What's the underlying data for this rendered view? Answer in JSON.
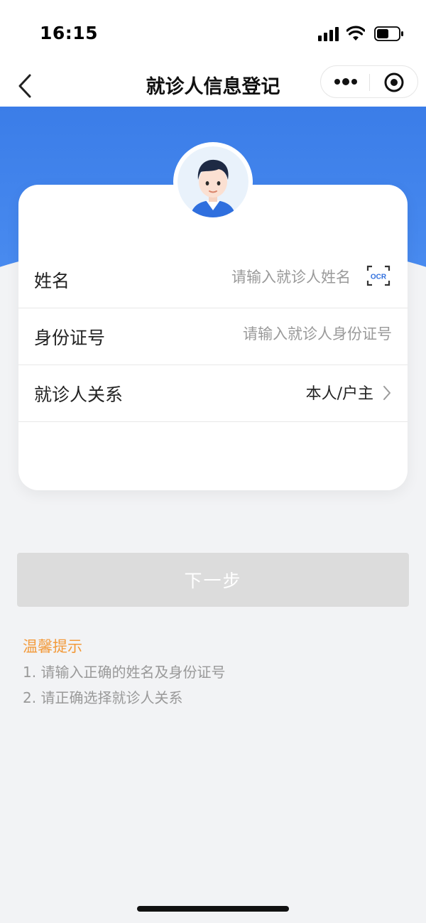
{
  "status_bar": {
    "time": "16:15"
  },
  "nav": {
    "title": "就诊人信息登记"
  },
  "form": {
    "name": {
      "label": "姓名",
      "placeholder": "请输入就诊人姓名",
      "ocr_label": "OCR"
    },
    "id_number": {
      "label": "身份证号",
      "placeholder": "请输入就诊人身份证号"
    },
    "relation": {
      "label": "就诊人关系",
      "value": "本人/户主"
    }
  },
  "actions": {
    "next_label": "下一步"
  },
  "tips": {
    "title": "温馨提示",
    "items": [
      "1. 请输入正确的姓名及身份证号",
      "2. 请正确选择就诊人关系"
    ]
  },
  "colors": {
    "accent_blue": "#3b7de8",
    "tip_orange": "#f39a3a",
    "button_disabled": "#dcdcdc"
  }
}
